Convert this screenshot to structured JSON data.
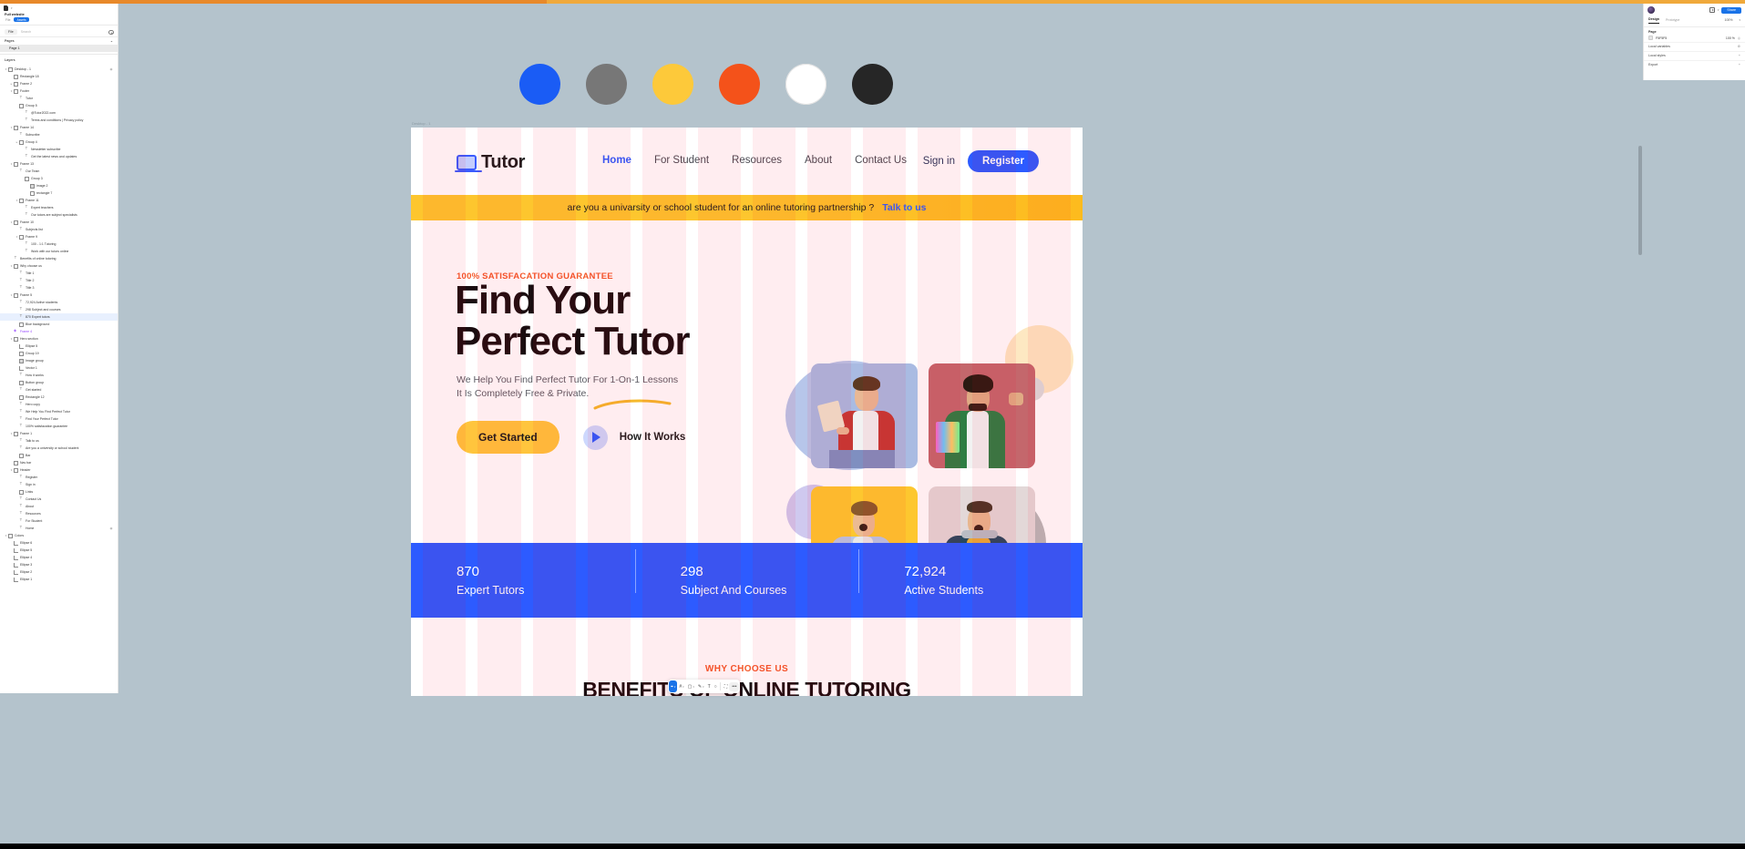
{
  "app": {
    "file_name": "Full website",
    "tabs": {
      "design": "Design",
      "prototype": "Prototype"
    },
    "file_tab": "File",
    "menu_tab": "Assets",
    "share_label": "Share",
    "zoom": "100%"
  },
  "left_panel": {
    "search_placeholder": "Search",
    "pages_label": "Pages",
    "pages": [
      {
        "name": "Page 1"
      }
    ],
    "layers_label": "Layers",
    "layers": [
      {
        "indent": 0,
        "arrow": "▾",
        "icon": "frame",
        "label": "Desktop - 1",
        "eye": "◉"
      },
      {
        "indent": 1,
        "arrow": "",
        "icon": "rect",
        "label": "Rectangle 18",
        "eye": ""
      },
      {
        "indent": 1,
        "arrow": "▸",
        "icon": "frame",
        "label": "Frame 2",
        "eye": ""
      },
      {
        "indent": 1,
        "arrow": "▾",
        "icon": "frame",
        "label": "Footer",
        "eye": ""
      },
      {
        "indent": 2,
        "arrow": "",
        "icon": "text",
        "label": "Tutor",
        "eye": ""
      },
      {
        "indent": 2,
        "arrow": "",
        "icon": "group",
        "label": "Group 5",
        "eye": ""
      },
      {
        "indent": 3,
        "arrow": "",
        "icon": "text",
        "label": "@Tutor2022.com",
        "eye": ""
      },
      {
        "indent": 3,
        "arrow": "",
        "icon": "text",
        "label": "Terms and conditions | Privacy policy",
        "eye": ""
      },
      {
        "indent": 1,
        "arrow": "▾",
        "icon": "frame",
        "label": "Frame 14",
        "eye": ""
      },
      {
        "indent": 2,
        "arrow": "",
        "icon": "text",
        "label": "Subscribe",
        "eye": ""
      },
      {
        "indent": 2,
        "arrow": "▸",
        "icon": "group",
        "label": "Group 4",
        "eye": ""
      },
      {
        "indent": 3,
        "arrow": "",
        "icon": "text",
        "label": "Newsletter subscribe",
        "eye": ""
      },
      {
        "indent": 3,
        "arrow": "",
        "icon": "text",
        "label": "Get the latest news and updates",
        "eye": ""
      },
      {
        "indent": 1,
        "arrow": "▾",
        "icon": "frame",
        "label": "Frame 13",
        "eye": ""
      },
      {
        "indent": 2,
        "arrow": "",
        "icon": "text",
        "label": "Our Team",
        "eye": ""
      },
      {
        "indent": 3,
        "arrow": "",
        "icon": "group",
        "label": "Group 3",
        "eye": ""
      },
      {
        "indent": 4,
        "arrow": "",
        "icon": "img",
        "label": "image 2",
        "eye": ""
      },
      {
        "indent": 4,
        "arrow": "",
        "icon": "rect",
        "label": "rectangle 7",
        "eye": ""
      },
      {
        "indent": 2,
        "arrow": "▾",
        "icon": "frame",
        "label": "Frame 11",
        "eye": ""
      },
      {
        "indent": 3,
        "arrow": "",
        "icon": "text",
        "label": "Expert teachers",
        "eye": ""
      },
      {
        "indent": 3,
        "arrow": "",
        "icon": "text",
        "label": "Our tutors are subject specialists",
        "eye": ""
      },
      {
        "indent": 1,
        "arrow": "▾",
        "icon": "frame",
        "label": "Frame 10",
        "eye": ""
      },
      {
        "indent": 2,
        "arrow": "",
        "icon": "text",
        "label": "Subjects list",
        "eye": ""
      },
      {
        "indent": 2,
        "arrow": "▾",
        "icon": "frame",
        "label": "Frame 9",
        "eye": ""
      },
      {
        "indent": 3,
        "arrow": "",
        "icon": "text",
        "label": "100 - 1:1 Tutoring",
        "eye": ""
      },
      {
        "indent": 3,
        "arrow": "",
        "icon": "text",
        "label": "Work with our tutors online",
        "eye": ""
      },
      {
        "indent": 1,
        "arrow": "",
        "icon": "text",
        "label": "Benefits of online tutoring",
        "eye": ""
      },
      {
        "indent": 1,
        "arrow": "▾",
        "icon": "frame",
        "label": "Why choose us",
        "eye": ""
      },
      {
        "indent": 2,
        "arrow": "",
        "icon": "text",
        "label": "Title 1",
        "eye": ""
      },
      {
        "indent": 2,
        "arrow": "",
        "icon": "text",
        "label": "Title 2",
        "eye": ""
      },
      {
        "indent": 2,
        "arrow": "",
        "icon": "text",
        "label": "Title 3",
        "eye": ""
      },
      {
        "indent": 1,
        "arrow": "▾",
        "icon": "frame",
        "label": "Frame 5",
        "eye": ""
      },
      {
        "indent": 2,
        "arrow": "",
        "icon": "text",
        "label": "72,924 Active students",
        "eye": ""
      },
      {
        "indent": 2,
        "arrow": "",
        "icon": "text",
        "label": "298 Subject and courses",
        "eye": ""
      },
      {
        "indent": 2,
        "arrow": "",
        "icon": "text",
        "label": "870 Expert tutors",
        "eye": "",
        "selected": true
      },
      {
        "indent": 2,
        "arrow": "",
        "icon": "rect",
        "label": "Blue background",
        "eye": ""
      },
      {
        "indent": 1,
        "arrow": "",
        "icon": "comp",
        "label": "Frame 4",
        "eye": ""
      },
      {
        "indent": 1,
        "arrow": "▾",
        "icon": "frame",
        "label": "Hero section",
        "eye": ""
      },
      {
        "indent": 2,
        "arrow": "",
        "icon": "vec",
        "label": "Ellipse 5",
        "eye": ""
      },
      {
        "indent": 2,
        "arrow": "",
        "icon": "group",
        "label": "Group 19",
        "eye": ""
      },
      {
        "indent": 2,
        "arrow": "",
        "icon": "img",
        "label": "Image group",
        "eye": ""
      },
      {
        "indent": 2,
        "arrow": "",
        "icon": "vec",
        "label": "Vector 1",
        "eye": ""
      },
      {
        "indent": 2,
        "arrow": "",
        "icon": "text",
        "label": "How it works",
        "eye": ""
      },
      {
        "indent": 2,
        "arrow": "",
        "icon": "group",
        "label": "Button group",
        "eye": ""
      },
      {
        "indent": 2,
        "arrow": "",
        "icon": "text",
        "label": "Get started",
        "eye": ""
      },
      {
        "indent": 2,
        "arrow": "",
        "icon": "rect",
        "label": "Rectangle 12",
        "eye": ""
      },
      {
        "indent": 2,
        "arrow": "",
        "icon": "text",
        "label": "Hero copy",
        "eye": ""
      },
      {
        "indent": 2,
        "arrow": "",
        "icon": "text",
        "label": "We Help You Find Perfect Tutor",
        "eye": ""
      },
      {
        "indent": 2,
        "arrow": "",
        "icon": "text",
        "label": "Find Your Perfect Tutor",
        "eye": ""
      },
      {
        "indent": 2,
        "arrow": "",
        "icon": "text",
        "label": "100% satisfacation guarantee",
        "eye": ""
      },
      {
        "indent": 1,
        "arrow": "▾",
        "icon": "frame",
        "label": "Frame 1",
        "eye": ""
      },
      {
        "indent": 2,
        "arrow": "",
        "icon": "text",
        "label": "Talk to us",
        "eye": ""
      },
      {
        "indent": 2,
        "arrow": "",
        "icon": "text",
        "label": "Are you a university or school student",
        "eye": ""
      },
      {
        "indent": 2,
        "arrow": "",
        "icon": "rect",
        "label": "Bar",
        "eye": ""
      },
      {
        "indent": 1,
        "arrow": "",
        "icon": "group",
        "label": "Nav bar",
        "eye": ""
      },
      {
        "indent": 1,
        "arrow": "▾",
        "icon": "frame",
        "label": "Header",
        "eye": ""
      },
      {
        "indent": 2,
        "arrow": "",
        "icon": "text",
        "label": "Register",
        "eye": ""
      },
      {
        "indent": 2,
        "arrow": "",
        "icon": "text",
        "label": "Sign in",
        "eye": ""
      },
      {
        "indent": 2,
        "arrow": "",
        "icon": "group",
        "label": "Links",
        "eye": ""
      },
      {
        "indent": 2,
        "arrow": "",
        "icon": "text",
        "label": "Contact Us",
        "eye": ""
      },
      {
        "indent": 2,
        "arrow": "",
        "icon": "text",
        "label": "About",
        "eye": ""
      },
      {
        "indent": 2,
        "arrow": "",
        "icon": "text",
        "label": "Resources",
        "eye": ""
      },
      {
        "indent": 2,
        "arrow": "",
        "icon": "text",
        "label": "For Student",
        "eye": ""
      },
      {
        "indent": 2,
        "arrow": "",
        "icon": "text",
        "label": "Home",
        "eye": "◉"
      },
      {
        "indent": 0,
        "arrow": "▾",
        "icon": "frame",
        "label": "Colors",
        "eye": ""
      },
      {
        "indent": 1,
        "arrow": "",
        "icon": "vec",
        "label": "Ellipse 6",
        "eye": ""
      },
      {
        "indent": 1,
        "arrow": "",
        "icon": "vec",
        "label": "Ellipse 5",
        "eye": ""
      },
      {
        "indent": 1,
        "arrow": "",
        "icon": "vec",
        "label": "Ellipse 4",
        "eye": ""
      },
      {
        "indent": 1,
        "arrow": "",
        "icon": "vec",
        "label": "Ellipse 3",
        "eye": ""
      },
      {
        "indent": 1,
        "arrow": "",
        "icon": "vec",
        "label": "Ellipse 2",
        "eye": ""
      },
      {
        "indent": 1,
        "arrow": "",
        "icon": "vec",
        "label": "Ellipse 1",
        "eye": ""
      }
    ]
  },
  "right_panel": {
    "page_label": "Page",
    "background_label": "Background",
    "background_value": "F5F5F5",
    "background_opacity": "100 %",
    "local_variables": "Local variables",
    "local_styles": "Local styles",
    "export_label": "Export"
  },
  "toolbar": {
    "items": [
      {
        "name": "move-tool",
        "glyph": "⌖",
        "caret": "▾",
        "active": true
      },
      {
        "name": "frame-tool",
        "glyph": "#",
        "caret": "▾",
        "active": false
      },
      {
        "name": "shape-tool",
        "glyph": "▢",
        "caret": "▾",
        "active": false
      },
      {
        "name": "pen-tool",
        "glyph": "✎",
        "caret": "▾",
        "active": false
      },
      {
        "name": "text-tool",
        "glyph": "T",
        "caret": "",
        "active": false
      },
      {
        "name": "comment-tool",
        "glyph": "○",
        "caret": "",
        "active": false
      },
      {
        "name": "resources-tool",
        "glyph": "⛶",
        "caret": "",
        "active": false
      }
    ],
    "actions_chip": "•••"
  },
  "canvas": {
    "frame_label": "Desktop - 1",
    "swatches": [
      {
        "name": "blue",
        "hex": "#1a5cf5"
      },
      {
        "name": "gray",
        "hex": "#777777"
      },
      {
        "name": "yellow",
        "hex": "#fdc93a"
      },
      {
        "name": "orange",
        "hex": "#f4521a"
      },
      {
        "name": "white",
        "hex": "#ffffff"
      },
      {
        "name": "near-black",
        "hex": "#262626"
      }
    ]
  },
  "site": {
    "logo_text": "Tutor",
    "nav_links": [
      {
        "label": "Home",
        "active": true
      },
      {
        "label": "For Student",
        "active": false
      },
      {
        "label": "Resources",
        "active": false
      },
      {
        "label": "About",
        "active": false
      },
      {
        "label": "Contact Us",
        "active": false
      }
    ],
    "sign_in": "Sign in",
    "register": "Register",
    "announce_text": "are you a univarsity or school student for an online tutoring partnership ?",
    "announce_link": "Talk to us",
    "hero": {
      "kicker": "100% SATISFACATION GUARANTEE",
      "title_line1": "Find Your",
      "title_line2": "Perfect Tutor",
      "lead_line1": "We Help You Find Perfect Tutor For 1-On-1 Lessons",
      "lead_line2": "It Is Completely Free & Private.",
      "cta_primary": "Get Started",
      "cta_secondary": "How It Works"
    },
    "stats": [
      {
        "number": "870",
        "label": "Expert Tutors"
      },
      {
        "number": "298",
        "label": "Subject And Courses"
      },
      {
        "number": "72,924",
        "label": "Active Students"
      }
    ],
    "why": {
      "kicker": "WHY CHOOSE US",
      "title": "BENEFITS OF ONLINE TUTORING"
    }
  }
}
